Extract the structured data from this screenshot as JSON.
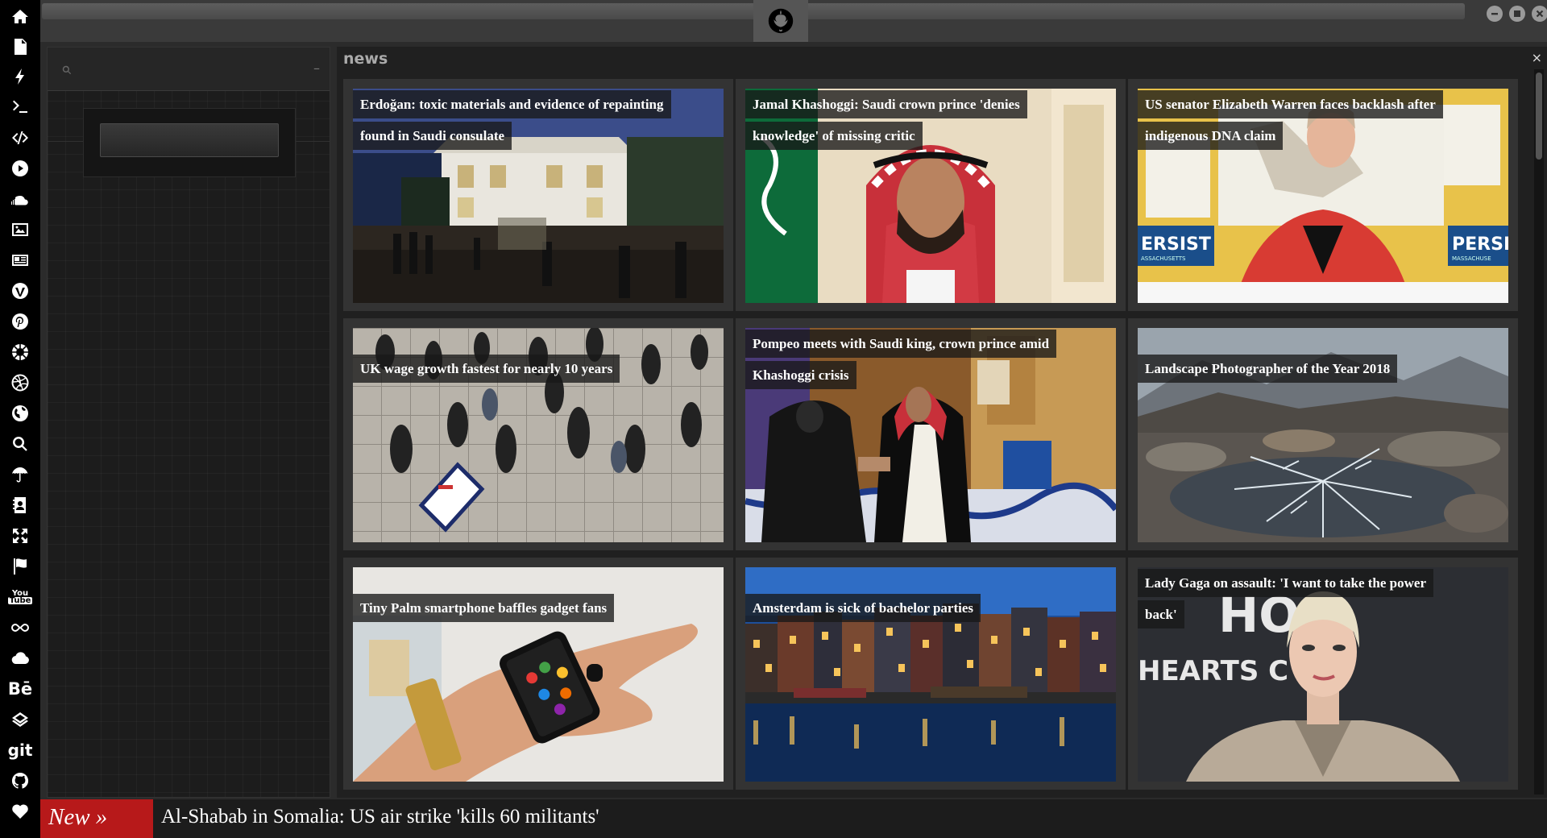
{
  "sidebar": {
    "icons": [
      "home-icon",
      "document-icon",
      "lightning-icon",
      "terminal-icon",
      "code-icon",
      "play-icon",
      "soundcloud-icon",
      "image-icon",
      "newspaper-icon",
      "wordpress-icon",
      "pinterest-icon",
      "aperture-icon",
      "dribbble-icon",
      "globe-icon",
      "search-icon",
      "umbrella-icon",
      "contacts-icon",
      "expand-icon",
      "flag-icon",
      "youtube-icon",
      "infinity-icon",
      "cloud-icon",
      "behance-icon",
      "codepen-icon",
      "git-icon",
      "github-icon",
      "heart-icon"
    ],
    "youtube_top": "You",
    "youtube_bottom": "Tube",
    "behance": "Bē",
    "git": "git"
  },
  "titlebar": {
    "logo": "rebel-alliance-logo",
    "buttons": [
      "minimize",
      "maximize",
      "close"
    ]
  },
  "left_panel": {
    "search": {
      "value": "",
      "placeholder": ""
    },
    "collapse": "–"
  },
  "news": {
    "title": "news",
    "close": "×",
    "cards": [
      {
        "caption": "Erdoğan: toxic materials and evidence of repainting found in Saudi consulate",
        "scene": "night street with white consulate building"
      },
      {
        "caption": "Jamal Khashoggi: Saudi crown prince 'denies knowledge' of missing critic",
        "scene": "crown prince in red keffiyeh"
      },
      {
        "caption": "US senator Elizabeth Warren faces backlash after indigenous DNA claim",
        "scene": "senator in red jacket"
      },
      {
        "caption": "UK wage growth fastest for nearly 10 years",
        "scene": "commuters walking over tiled pavement"
      },
      {
        "caption": "Pompeo meets with Saudi king, crown prince amid Khashoggi crisis",
        "scene": "handshake in ornate room"
      },
      {
        "caption": "Landscape Photographer of the Year 2018",
        "scene": "frozen puddle among rocks and mountains"
      },
      {
        "caption": "Tiny Palm smartphone baffles gadget fans",
        "scene": "hand holding small phone"
      },
      {
        "caption": "Amsterdam is sick of bachelor parties",
        "scene": "canal houses at dusk"
      },
      {
        "caption": "Lady Gaga on assault: 'I want to take the power back'",
        "scene": "woman at event backdrop"
      }
    ],
    "card3_backdrop_1": "ERSIST",
    "card3_backdrop_1_small": "ASSACHUSETTS",
    "card3_backdrop_2": "PERSIS",
    "card3_backdrop_2_small": "MASSACHUSE",
    "card9_backdrop_1": "HO",
    "card9_backdrop_2": "HEARTS C  RE"
  },
  "ticker": {
    "label": "New »",
    "headline": "Al-Shabab in Somalia: US air strike 'kills 60 militants'"
  },
  "colors": {
    "ticker_red": "#b7191a",
    "sidebar_bg": "#000000",
    "panel_bg": "#202020"
  }
}
